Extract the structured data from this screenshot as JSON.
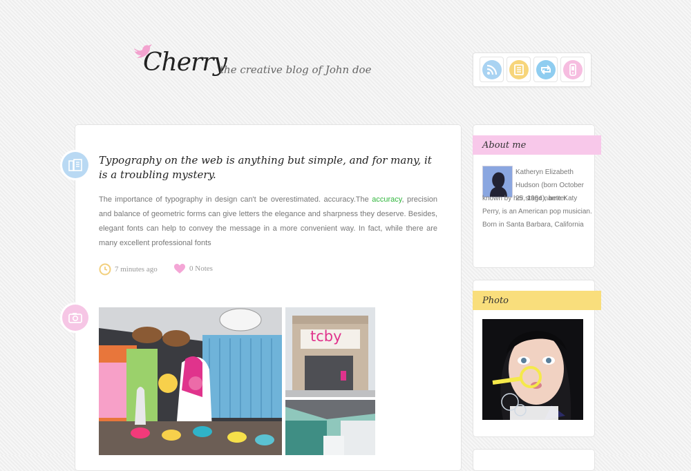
{
  "header": {
    "logo_text": "Cherry",
    "tagline": "the creative blog of John doe"
  },
  "social": [
    {
      "name": "rss",
      "icon": "rss-icon",
      "color": "#a9d3f2"
    },
    {
      "name": "notes",
      "icon": "notes-icon",
      "color": "#f7d57a"
    },
    {
      "name": "reblog",
      "icon": "reblog-icon",
      "color": "#8fcdf0"
    },
    {
      "name": "mobile",
      "icon": "mobile-icon",
      "color": "#f6bde0"
    }
  ],
  "post": {
    "title": "Typography on the web is anything but simple, and for many, it is a troubling mystery.",
    "body_before": "The importance of typography in design can't be overestimated. accuracy.The ",
    "body_link": "accuracy",
    "body_after": ", precision and balance of geometric forms can give letters the elegance and sharpness they deserve. Besides, elegant fonts can help to convey the message in a more convenient way. In fact, while there are many excellent professional fonts",
    "time": "7 minutes ago",
    "notes": "0 Notes"
  },
  "sidebar": {
    "about": {
      "heading": "About me",
      "text_first": "Katheryn Elizabeth Hudson (born October 25, 1984), better",
      "text_rest": "known by her stage name Katy Perry, is an American pop musician. Born in Santa Barbara, California"
    },
    "photo": {
      "heading": "Photo"
    }
  },
  "colors": {
    "accent_green": "#31b63d",
    "about_ribbon": "#f8c8ea",
    "photo_ribbon": "#f9de7c",
    "post_icon_text": "#b9d9f3",
    "post_icon_photo": "#f6c6e5"
  }
}
